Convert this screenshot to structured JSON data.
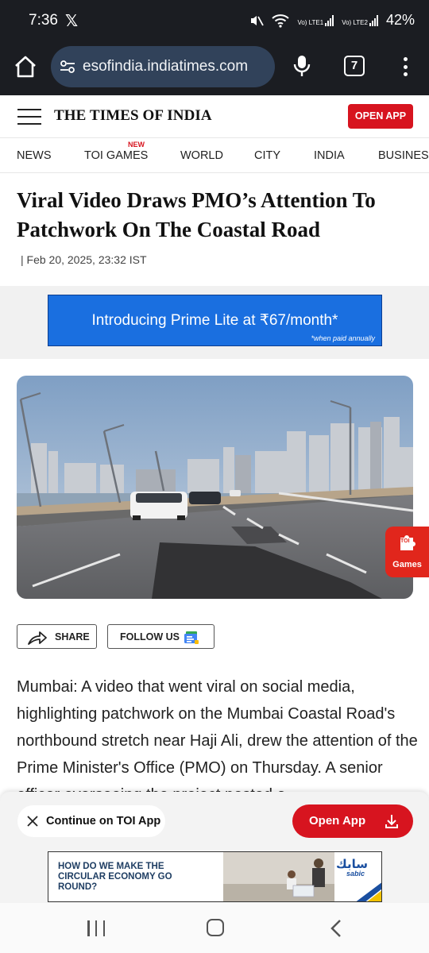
{
  "status_bar": {
    "time": "7:36",
    "x_logo": "𝕏",
    "sim1": "Vo) LTE1",
    "sim2": "Vo) LTE2",
    "battery": "42%"
  },
  "browser": {
    "url": "esofindia.indiatimes.com",
    "tab_count": "7",
    "bar_color": "#1b1d22",
    "url_box_color": "#31425a"
  },
  "site_header": {
    "logo": "THE TIMES OF INDIA",
    "open_app": "OPEN APP",
    "accent": "#d7141f"
  },
  "nav": {
    "items": [
      {
        "label": "NEWS"
      },
      {
        "label": "TOI GAMES",
        "badge": "NEW"
      },
      {
        "label": "WORLD"
      },
      {
        "label": "CITY"
      },
      {
        "label": "INDIA"
      },
      {
        "label": "BUSINESS"
      }
    ]
  },
  "article": {
    "headline": "Viral Video Draws PMO’s Attention To Patchwork On The Coastal Road",
    "date": "| Feb 20, 2025, 23:32 IST",
    "body": "Mumbai: A video that went viral on social media, highlighting patchwork on the Mumbai Coastal Road's northbound stretch near Haji Ali, drew the attention of the Prime Minister's Office (PMO) on Thursday. A senior officer overseeing the project posted a"
  },
  "ad_prime": {
    "text": "Introducing Prime Lite at ₹67/month*",
    "subtext": "*when paid annually"
  },
  "games_fab": {
    "label": "Games",
    "icon_text": "TOI"
  },
  "actions": {
    "share": "SHARE",
    "follow": "FOLLOW US"
  },
  "bottom_bar": {
    "continue_label": "Continue on TOI App",
    "open_app_label": "Open App"
  },
  "ad_sabic": {
    "text": "HOW DO WE MAKE THE CIRCULAR ECONOMY GO ROUND?",
    "brand_ar": "سابك",
    "brand_en": "sabic"
  }
}
